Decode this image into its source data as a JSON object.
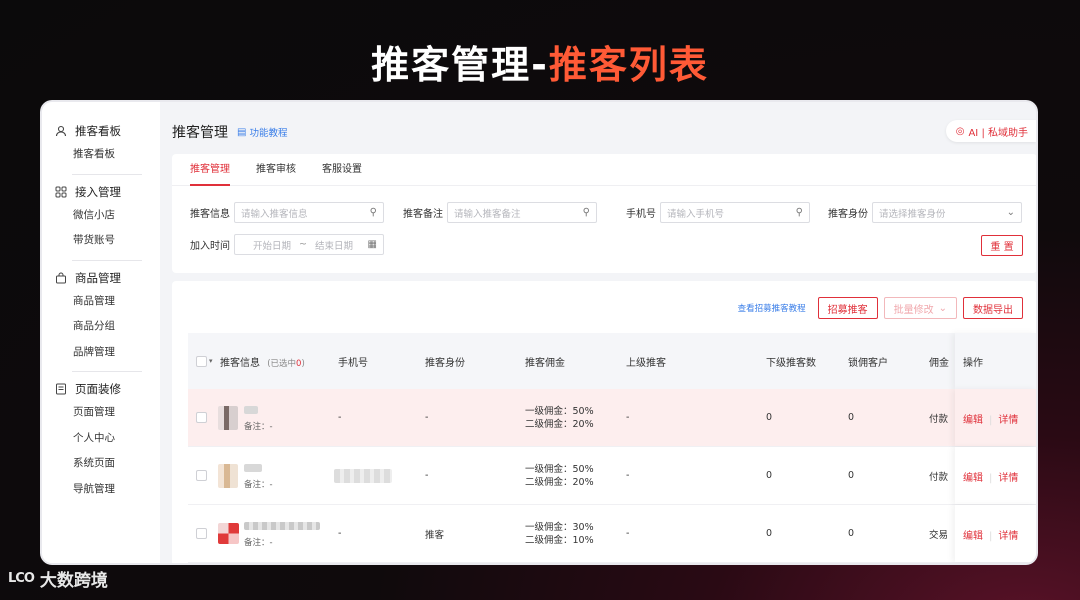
{
  "headline": {
    "part1": "推客管理-",
    "part2": "推客列表"
  },
  "sidebar": {
    "groups": [
      {
        "title": "推客看板",
        "icon": "user-icon",
        "items": [
          "推客看板"
        ]
      },
      {
        "title": "接入管理",
        "icon": "grid-icon",
        "items": [
          "微信小店",
          "带货账号"
        ]
      },
      {
        "title": "商品管理",
        "icon": "bag-icon",
        "items": [
          "商品管理",
          "商品分组",
          "品牌管理"
        ]
      },
      {
        "title": "页面装修",
        "icon": "page-icon",
        "items": [
          "页面管理",
          "个人中心",
          "系统页面",
          "导航管理"
        ]
      }
    ]
  },
  "header": {
    "title": "推客管理",
    "tutorial": "功能教程",
    "ai_label": "AI | 私域助手"
  },
  "tabs": [
    "推客管理",
    "推客审核",
    "客服设置"
  ],
  "filters": {
    "info_label": "推客信息",
    "info_placeholder": "请输入推客信息",
    "note_label": "推客备注",
    "note_placeholder": "请输入推客备注",
    "phone_label": "手机号",
    "phone_placeholder": "请输入手机号",
    "identity_label": "推客身份",
    "identity_placeholder": "请选择推客身份",
    "date_label": "加入时间",
    "date_start": "开始日期",
    "date_sep": "~",
    "date_end": "结束日期",
    "reset": "重 置"
  },
  "list_actions": {
    "tutorial": "查看招募推客教程",
    "recruit": "招募推客",
    "batch": "批量修改",
    "export": "数据导出"
  },
  "table": {
    "headers": {
      "info": "推客信息",
      "selected": "(已选中",
      "selected_count": "0",
      "selected_close": ")",
      "phone": "手机号",
      "identity": "推客身份",
      "commission": "推客佣金",
      "parent": "上级推客",
      "children": "下级推客数",
      "locked": "锁佣客户",
      "extra": "佣金",
      "ops": "操作"
    },
    "rows": [
      {
        "note": "备注：-",
        "phone": "-",
        "identity": "-",
        "comm1": "一级佣金：50%",
        "comm2": "二级佣金：20%",
        "parent": "-",
        "children": "0",
        "locked": "0",
        "extra": "付款",
        "edit": "编辑",
        "detail": "详情"
      },
      {
        "note": "备注：-",
        "phone": "",
        "identity": "-",
        "comm1": "一级佣金：50%",
        "comm2": "二级佣金：20%",
        "parent": "-",
        "children": "0",
        "locked": "0",
        "extra": "付款",
        "edit": "编辑",
        "detail": "详情"
      },
      {
        "note": "备注：-",
        "phone": "-",
        "identity": "推客",
        "comm1": "一级佣金：30%",
        "comm2": "二级佣金：10%",
        "parent": "-",
        "children": "0",
        "locked": "0",
        "extra": "交易",
        "edit": "编辑",
        "detail": "详情"
      }
    ]
  },
  "footer": {
    "mark": "LCO",
    "name": "大数跨境"
  }
}
